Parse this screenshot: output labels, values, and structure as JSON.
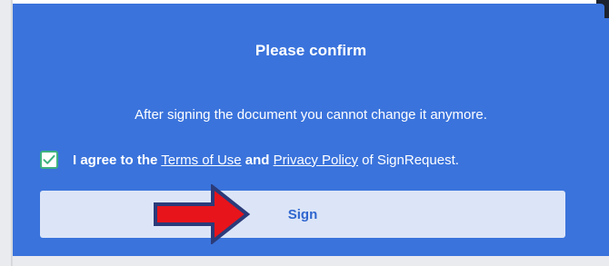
{
  "dialog": {
    "title": "Please confirm",
    "message": "After signing the document you cannot change it anymore.",
    "agree": {
      "checked": true,
      "prefix": "I agree to the",
      "terms_link": "Terms of Use",
      "and": "and",
      "privacy_link": "Privacy Policy",
      "suffix": "of SignRequest."
    },
    "sign_button": "Sign"
  },
  "colors": {
    "dialog_bg": "#3a73dc",
    "button_bg": "#dce5f7",
    "button_text": "#2f66cf",
    "checkbox_border": "#3fb27f",
    "arrow_fill": "#e8141b",
    "arrow_stroke": "#2b3b7a"
  },
  "icons": {
    "checkbox": "check-icon",
    "annotation": "red-arrow-icon"
  }
}
